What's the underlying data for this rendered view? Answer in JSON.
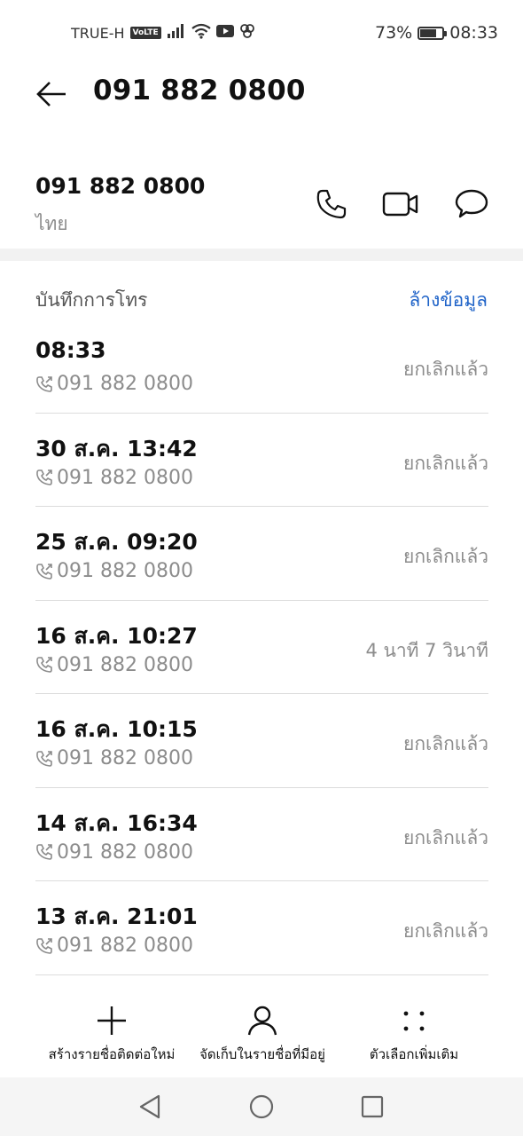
{
  "status_bar": {
    "carrier": "TRUE-H",
    "volte": "VoLTE",
    "battery_percent_text": "73%",
    "battery_level": 0.73,
    "time": "08:33"
  },
  "header": {
    "title": "091 882 0800"
  },
  "contact": {
    "number": "091 882 0800",
    "region": "ไทย"
  },
  "call_log": {
    "title": "บันทึกการโทร",
    "clear_label": "ล้างข้อมูล",
    "entries": [
      {
        "time": "08:33",
        "number": "091 882 0800",
        "status": "ยกเลิกแล้ว"
      },
      {
        "time": "30 ส.ค. 13:42",
        "number": "091 882 0800",
        "status": "ยกเลิกแล้ว"
      },
      {
        "time": "25 ส.ค. 09:20",
        "number": "091 882 0800",
        "status": "ยกเลิกแล้ว"
      },
      {
        "time": "16 ส.ค. 10:27",
        "number": "091 882 0800",
        "status": "4 นาที 7 วินาที"
      },
      {
        "time": "16 ส.ค. 10:15",
        "number": "091 882 0800",
        "status": "ยกเลิกแล้ว"
      },
      {
        "time": "14 ส.ค. 16:34",
        "number": "091 882 0800",
        "status": "ยกเลิกแล้ว"
      },
      {
        "time": "13 ส.ค. 21:01",
        "number": "091 882 0800",
        "status": "ยกเลิกแล้ว"
      }
    ]
  },
  "bottom_actions": {
    "new_contact": "สร้างรายชื่อติดต่อใหม่",
    "save_existing": "จัดเก็บในรายชื่อที่มีอยู่",
    "more_options": "ตัวเลือกเพิ่มเติม"
  },
  "colors": {
    "accent": "#1f63c8",
    "secondary_text": "#8c8c8c",
    "divider": "#dcdcdc"
  },
  "icons": {
    "back": "arrow-left-icon",
    "call": "phone-icon",
    "video": "video-camera-icon",
    "message": "chat-bubble-icon",
    "call_type": "outgoing-call-icon",
    "add": "plus-icon",
    "person": "person-icon",
    "more": "dots-grid-icon",
    "nav_back": "triangle-back-icon",
    "nav_home": "circle-home-icon",
    "nav_recent": "square-recents-icon"
  }
}
